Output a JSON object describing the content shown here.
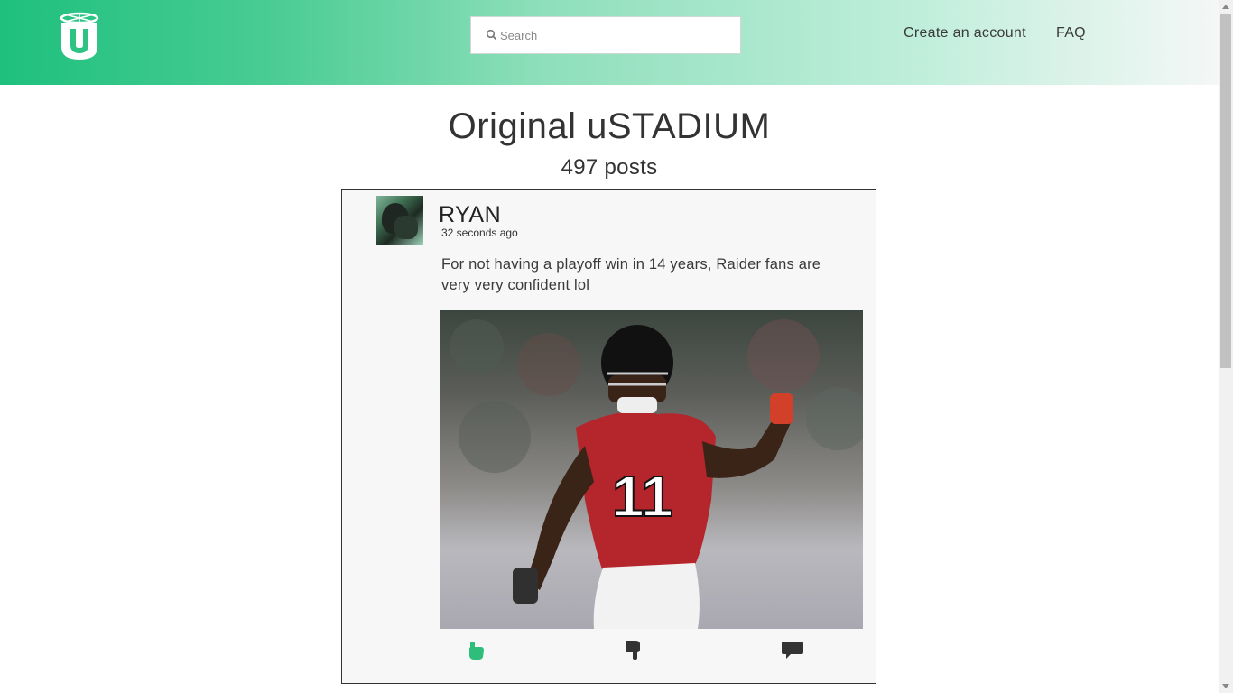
{
  "header": {
    "logo_icon": "ustadium-logo-icon",
    "search": {
      "placeholder": "Search",
      "icon": "search-icon"
    },
    "nav": {
      "create_account": "Create an account",
      "faq": "FAQ"
    },
    "colors": {
      "gradient_start": "#1ec07d",
      "gradient_end": "#f4f7f6"
    }
  },
  "main": {
    "title": "Original uSTADIUM",
    "post_count": "497 posts"
  },
  "post": {
    "username": "RYAN",
    "timestamp": "32 seconds ago",
    "text": "For not having a playoff win in 14 years, Raider fans are very very confident lol",
    "image_jersey_number": "11",
    "actions": {
      "like_icon": "thumbs-up-icon",
      "dislike_icon": "thumbs-down-icon",
      "comment_icon": "comment-icon"
    },
    "colors": {
      "like_active": "#2ebd7a",
      "inactive": "#333333"
    }
  }
}
